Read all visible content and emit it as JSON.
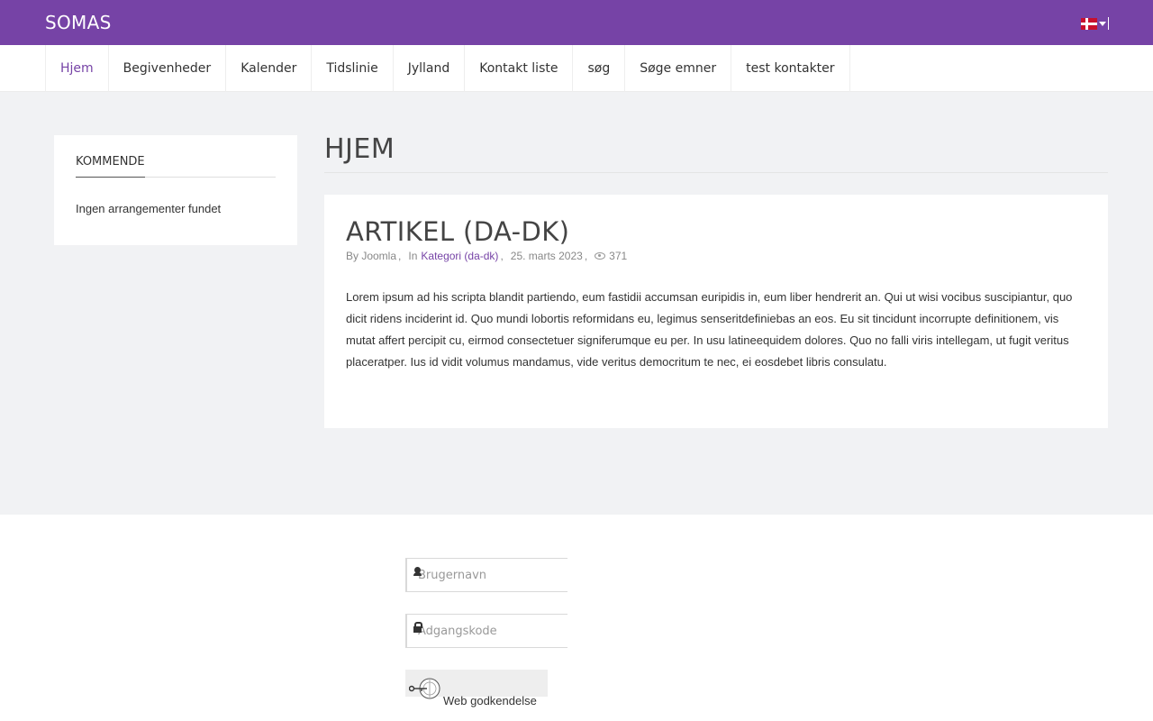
{
  "site": {
    "title": "SOMAS"
  },
  "nav": {
    "items": [
      {
        "label": "Hjem",
        "active": true
      },
      {
        "label": "Begivenheder"
      },
      {
        "label": "Kalender"
      },
      {
        "label": "Tidslinie"
      },
      {
        "label": "Jylland"
      },
      {
        "label": "Kontakt liste"
      },
      {
        "label": "søg"
      },
      {
        "label": "Søge emner"
      },
      {
        "label": "test kontakter"
      }
    ]
  },
  "sidebar": {
    "module_title": "KOMMENDE",
    "empty_text": "Ingen arrangementer fundet"
  },
  "page": {
    "title": "HJEM"
  },
  "article": {
    "title": "ARTIKEL (DA-DK)",
    "meta": {
      "author": "By Joomla",
      "in_label": "In",
      "category": "Kategori (da-dk)",
      "date": "25. marts 2023",
      "hits": "371"
    },
    "body": "Lorem ipsum ad his scripta blandit partiendo, eum fastidii accumsan euripidis in, eum liber hendrerit an. Qui ut wisi vocibus suscipiantur, quo dicit ridens inciderint id. Quo mundi lobortis reformidans eu, legimus senseritdefiniebas an eos. Eu sit tincidunt incorrupte definitionem, vis mutat affert percipit cu, eirmod consectetuer signiferumque eu per. In usu latineequidem dolores. Quo no falli viris intellegam, ut fugit veritus placeratper. Ius id vidit volumus mandamus, vide veritus democritum te nec, ei eosdebet libris consulatu."
  },
  "login": {
    "username_placeholder": "Brugernavn",
    "password_placeholder": "Adgangskode",
    "webauthn_label": "Web godkendelse"
  },
  "icons": {
    "language_flag": "denmark-flag-icon",
    "hits": "eye-icon",
    "username": "user-icon",
    "password": "lock-icon",
    "webauthn": "passkey-icon"
  },
  "colors": {
    "brand": "#7643a6",
    "background": "#f1f2f4"
  }
}
